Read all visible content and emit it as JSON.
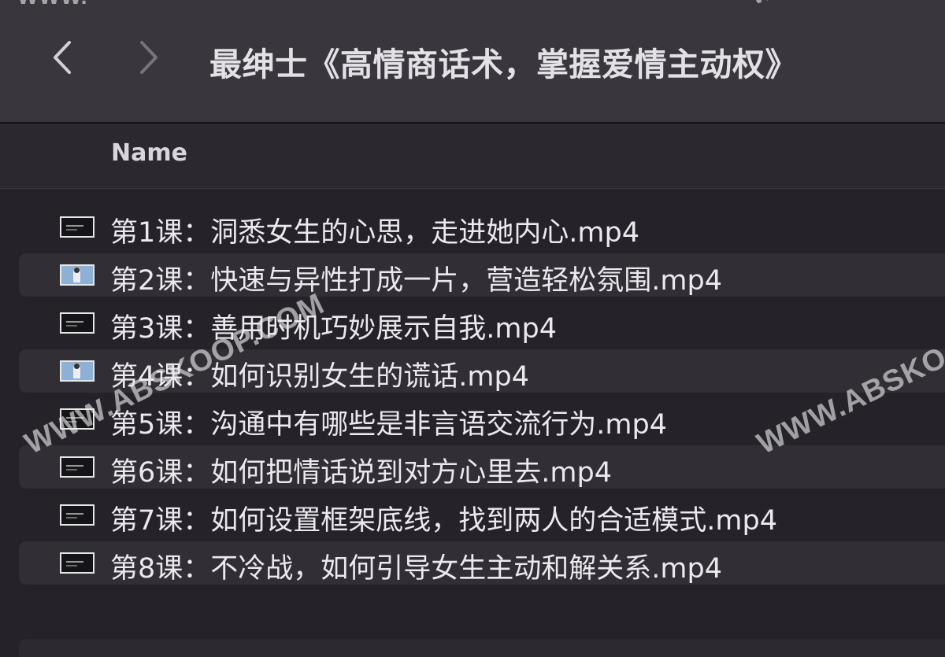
{
  "window": {
    "title": "最绅士《高情商话术，掌握爱情主动权》"
  },
  "toolbar": {
    "back_icon": "chevron-left-icon",
    "forward_icon": "chevron-right-icon"
  },
  "columns": {
    "name": "Name"
  },
  "files": [
    {
      "name": "第1课：洞悉女生的心思，走进她内心.mp4",
      "thumbnail": "dark"
    },
    {
      "name": "第2课：快速与异性打成一片，营造轻松氛围.mp4",
      "thumbnail": "light"
    },
    {
      "name": "第3课：善用时机巧妙展示自我.mp4",
      "thumbnail": "dark"
    },
    {
      "name": "第4课：如何识别女生的谎话.mp4",
      "thumbnail": "light"
    },
    {
      "name": "第5课：沟通中有哪些是非言语交流行为.mp4",
      "thumbnail": "dark"
    },
    {
      "name": "第6课：如何把情话说到对方心里去.mp4",
      "thumbnail": "dark"
    },
    {
      "name": "第7课：如何设置框架底线，找到两人的合适模式.mp4",
      "thumbnail": "dark"
    },
    {
      "name": "第8课：不冷战，如何引导女生主动和解关系.mp4",
      "thumbnail": "dark"
    }
  ],
  "watermarks": {
    "top_left": "WWW.",
    "top_right": "WWW",
    "center": "WWW.ABSKOOP.COM",
    "right": "WWW.ABSKO"
  },
  "colors": {
    "toolbar_bg": "#3a363d",
    "list_bg": "#26222a",
    "row_alt_bg": "#322e35",
    "text": "#ebe9ee"
  }
}
